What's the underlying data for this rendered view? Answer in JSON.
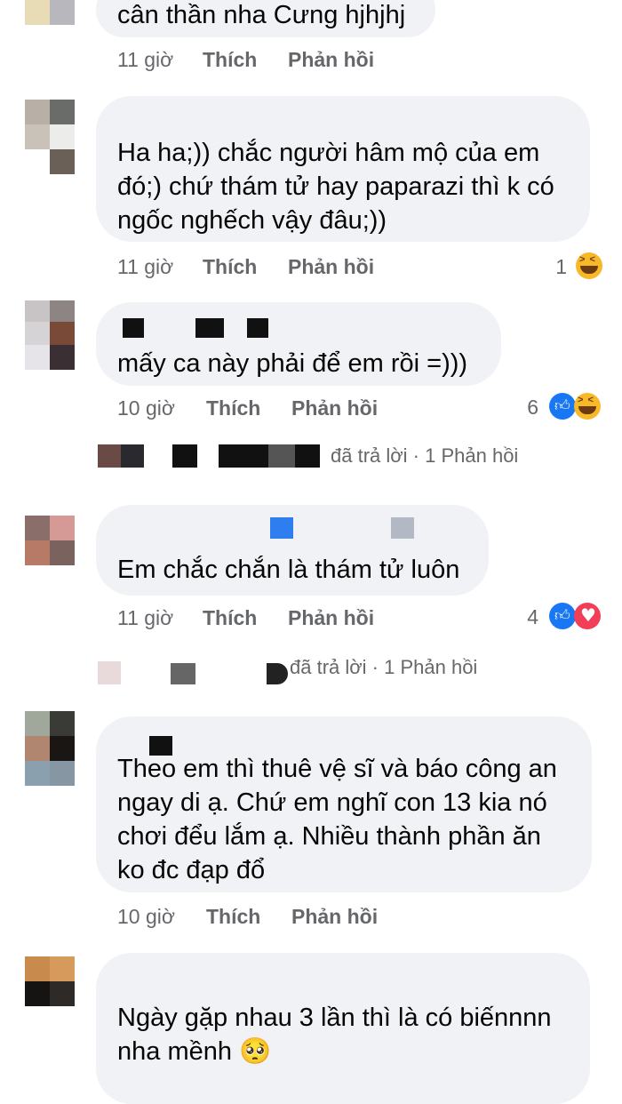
{
  "comments": [
    {
      "text": "cân thần nha Cưng hjhjhj",
      "time": "11 giờ",
      "like_label": "Thích",
      "reply_label": "Phản hồi"
    },
    {
      "text": "Ha ha;)) chắc người hâm mộ của em\nđó;) chứ thám tử hay paparazi thì k có\nngốc nghếch vậy đâu;))",
      "time": "11 giờ",
      "like_label": "Thích",
      "reply_label": "Phản hồi",
      "reaction_count": "1",
      "reactions": [
        "haha"
      ]
    },
    {
      "text": "mấy ca này phải để em rồi =)))",
      "time": "10 giờ",
      "like_label": "Thích",
      "reply_label": "Phản hồi",
      "reaction_count": "6",
      "reactions": [
        "like",
        "haha"
      ],
      "reply_summary": "đã trả lời · 1 Phản hồi"
    },
    {
      "text": "Em chắc chắn là thám tử luôn",
      "time": "11 giờ",
      "like_label": "Thích",
      "reply_label": "Phản hồi",
      "reaction_count": "4",
      "reactions": [
        "like",
        "love"
      ],
      "reply_summary": "đã trả lời · 1 Phản hồi"
    },
    {
      "text": "Theo em thì thuê vệ sĩ và báo công an\nngay di ạ. Chứ em nghĩ con 13 kia nó\nchơi đểu lắm ạ. Nhiều thành phần ăn\nko đc đạp đổ",
      "time": "10 giờ",
      "like_label": "Thích",
      "reply_label": "Phản hồi"
    },
    {
      "text": "Ngày gặp nhau 3 lần thì là có biếnnnn\nnha mềnh 🥺"
    }
  ],
  "colors": {
    "bubble": "#f0f2f5",
    "meta": "#65676b",
    "like": "#1877f2",
    "love": "#f33e58",
    "haha": "#f7b928"
  }
}
